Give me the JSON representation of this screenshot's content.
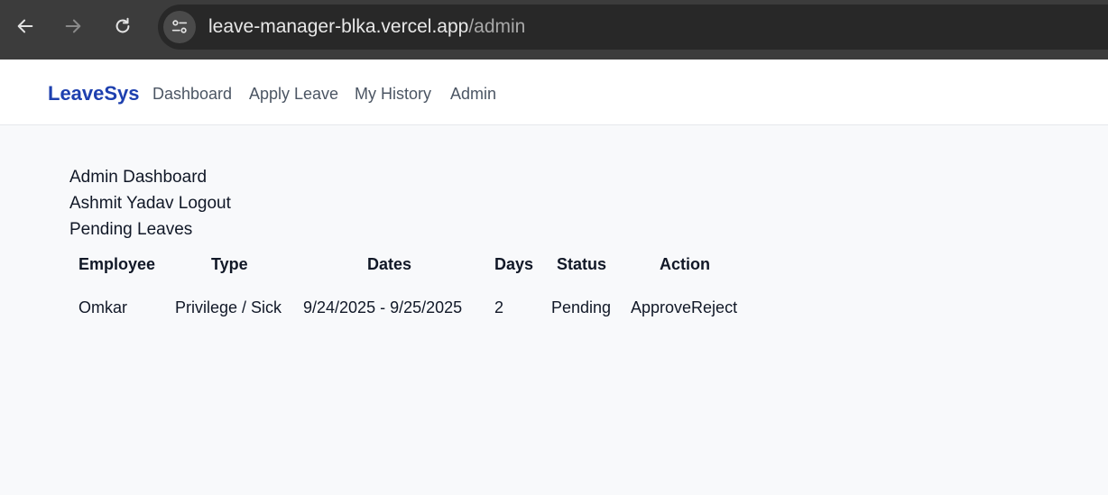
{
  "browser": {
    "url_host": "leave-manager-blka.vercel.app",
    "url_path": "/admin",
    "icons": [
      "back-arrow-icon",
      "forward-arrow-icon",
      "reload-icon",
      "site-settings-icon"
    ]
  },
  "nav": {
    "brand": "LeaveSys",
    "links": [
      "Dashboard",
      "Apply Leave",
      "My History",
      "Admin"
    ]
  },
  "page": {
    "title": "Admin Dashboard",
    "user_name": "Ashmit Yadav",
    "logout_label": "Logout",
    "section_title": "Pending Leaves"
  },
  "table": {
    "headers": [
      "Employee",
      "Type",
      "Dates",
      "Days",
      "Status",
      "Action"
    ],
    "rows": [
      {
        "employee": "Omkar",
        "type": "Privilege / Sick",
        "dates": "9/24/2025 - 9/25/2025",
        "days": "2",
        "status": "Pending",
        "approve_label": "Approve",
        "reject_label": "Reject"
      }
    ]
  },
  "colors": {
    "brand": "#1e40af",
    "page_bg": "#f8f9fb",
    "chrome_bg": "#3c3c3c"
  }
}
